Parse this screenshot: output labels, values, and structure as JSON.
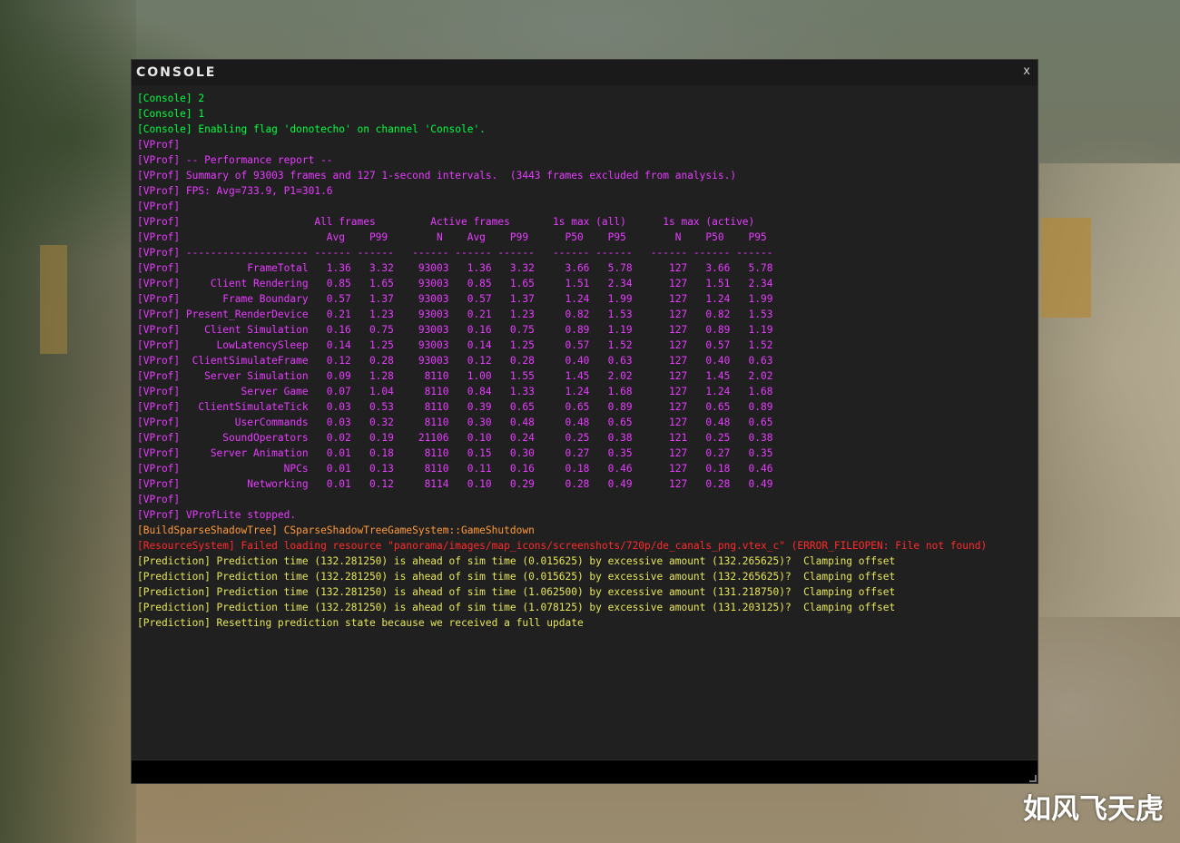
{
  "window": {
    "title": "CONSOLE",
    "close_label": "x"
  },
  "colors": {
    "green": "#00ff3e",
    "magenta": "#e73cff",
    "orange": "#ff9a3c",
    "red": "#ff2b2b",
    "yellow": "#e6e65a"
  },
  "lines": [
    {
      "text": "[Console] 2",
      "color": "green"
    },
    {
      "text": "[Console] 1",
      "color": "green"
    },
    {
      "text": "[Console] Enabling flag 'donotecho' on channel 'Console'.",
      "color": "green"
    },
    {
      "text": "[VProf]",
      "color": "magenta"
    },
    {
      "text": "[VProf] -- Performance report --",
      "color": "magenta"
    },
    {
      "text": "[VProf] Summary of 93003 frames and 127 1-second intervals.  (3443 frames excluded from analysis.)",
      "color": "magenta"
    },
    {
      "text": "[VProf] FPS: Avg=733.9, P1=301.6",
      "color": "magenta"
    },
    {
      "text": "[VProf]",
      "color": "magenta"
    },
    {
      "text": "[VProf]                      All frames         Active frames       1s max (all)      1s max (active)",
      "color": "magenta"
    },
    {
      "text": "[VProf]                        Avg    P99        N    Avg    P99      P50    P95        N    P50    P95",
      "color": "magenta"
    },
    {
      "text": "[VProf] -------------------- ------ ------   ------ ------ ------   ------ ------   ------ ------ ------",
      "color": "magenta"
    },
    {
      "text": "[VProf]           FrameTotal   1.36   3.32    93003   1.36   3.32     3.66   5.78      127   3.66   5.78",
      "color": "magenta"
    },
    {
      "text": "[VProf]     Client Rendering   0.85   1.65    93003   0.85   1.65     1.51   2.34      127   1.51   2.34",
      "color": "magenta"
    },
    {
      "text": "[VProf]       Frame Boundary   0.57   1.37    93003   0.57   1.37     1.24   1.99      127   1.24   1.99",
      "color": "magenta"
    },
    {
      "text": "[VProf] Present_RenderDevice   0.21   1.23    93003   0.21   1.23     0.82   1.53      127   0.82   1.53",
      "color": "magenta"
    },
    {
      "text": "[VProf]    Client Simulation   0.16   0.75    93003   0.16   0.75     0.89   1.19      127   0.89   1.19",
      "color": "magenta"
    },
    {
      "text": "[VProf]      LowLatencySleep   0.14   1.25    93003   0.14   1.25     0.57   1.52      127   0.57   1.52",
      "color": "magenta"
    },
    {
      "text": "[VProf]  ClientSimulateFrame   0.12   0.28    93003   0.12   0.28     0.40   0.63      127   0.40   0.63",
      "color": "magenta"
    },
    {
      "text": "[VProf]    Server Simulation   0.09   1.28     8110   1.00   1.55     1.45   2.02      127   1.45   2.02",
      "color": "magenta"
    },
    {
      "text": "[VProf]          Server Game   0.07   1.04     8110   0.84   1.33     1.24   1.68      127   1.24   1.68",
      "color": "magenta"
    },
    {
      "text": "[VProf]   ClientSimulateTick   0.03   0.53     8110   0.39   0.65     0.65   0.89      127   0.65   0.89",
      "color": "magenta"
    },
    {
      "text": "[VProf]         UserCommands   0.03   0.32     8110   0.30   0.48     0.48   0.65      127   0.48   0.65",
      "color": "magenta"
    },
    {
      "text": "[VProf]       SoundOperators   0.02   0.19    21106   0.10   0.24     0.25   0.38      121   0.25   0.38",
      "color": "magenta"
    },
    {
      "text": "[VProf]     Server Animation   0.01   0.18     8110   0.15   0.30     0.27   0.35      127   0.27   0.35",
      "color": "magenta"
    },
    {
      "text": "[VProf]                 NPCs   0.01   0.13     8110   0.11   0.16     0.18   0.46      127   0.18   0.46",
      "color": "magenta"
    },
    {
      "text": "[VProf]           Networking   0.01   0.12     8114   0.10   0.29     0.28   0.49      127   0.28   0.49",
      "color": "magenta"
    },
    {
      "text": "[VProf]",
      "color": "magenta"
    },
    {
      "text": "[VProf] VProfLite stopped.",
      "color": "magenta"
    },
    {
      "text": "[BuildSparseShadowTree] CSparseShadowTreeGameSystem::GameShutdown",
      "color": "orange"
    },
    {
      "text": "[ResourceSystem] Failed loading resource \"panorama/images/map_icons/screenshots/720p/de_canals_png.vtex_c\" (ERROR_FILEOPEN: File not found)",
      "color": "red"
    },
    {
      "text": "[Prediction] Prediction time (132.281250) is ahead of sim time (0.015625) by excessive amount (132.265625)?  Clamping offset",
      "color": "yellow"
    },
    {
      "text": "[Prediction] Prediction time (132.281250) is ahead of sim time (0.015625) by excessive amount (132.265625)?  Clamping offset",
      "color": "yellow"
    },
    {
      "text": "[Prediction] Prediction time (132.281250) is ahead of sim time (1.062500) by excessive amount (131.218750)?  Clamping offset",
      "color": "yellow"
    },
    {
      "text": "[Prediction] Prediction time (132.281250) is ahead of sim time (1.078125) by excessive amount (131.203125)?  Clamping offset",
      "color": "yellow"
    },
    {
      "text": "[Prediction] Resetting prediction state because we received a full update",
      "color": "yellow"
    }
  ],
  "input": {
    "value": "",
    "placeholder": ""
  },
  "watermark": "如风飞天虎"
}
